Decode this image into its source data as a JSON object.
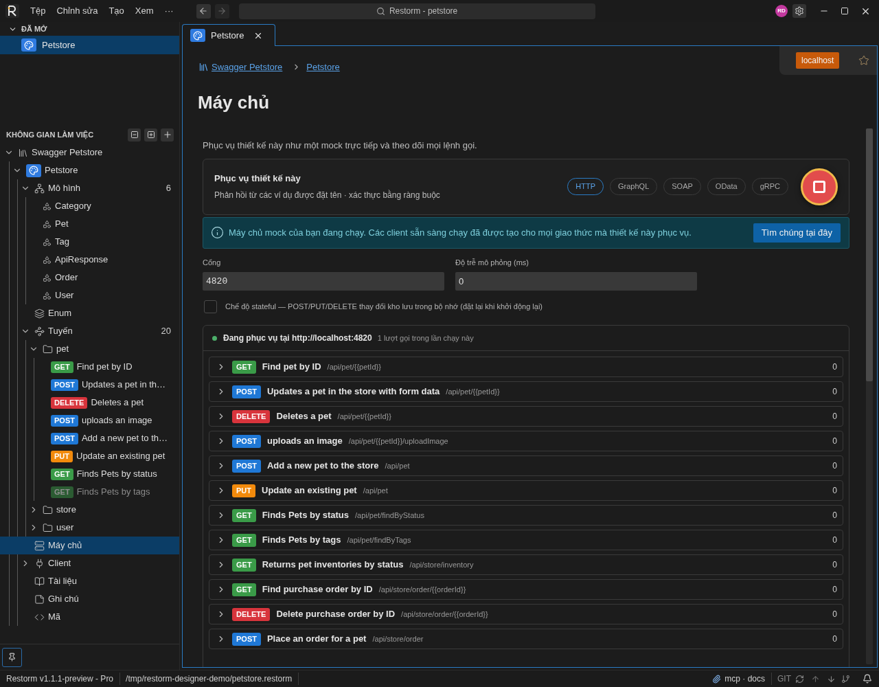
{
  "menu": [
    "Tệp",
    "Chỉnh sửa",
    "Tạo",
    "Xem",
    "···"
  ],
  "search": {
    "value": "Restorm - petstore"
  },
  "avatar": {
    "initials": "RD",
    "color": "#c2389e"
  },
  "open_section": {
    "title": "ĐÃ MỞ",
    "expanded": true,
    "items": [
      {
        "label": "Petstore",
        "selected": true
      }
    ]
  },
  "workspace": {
    "title": "KHÔNG GIAN LÀM VIỆC",
    "tree": [
      {
        "kind": "project",
        "label": "Swagger Petstore",
        "expanded": true,
        "children": [
          {
            "kind": "design",
            "label": "Petstore",
            "expanded": true,
            "children": [
              {
                "kind": "models",
                "label": "Mô hình",
                "count": "6",
                "expanded": true,
                "selected": false,
                "children": [
                  {
                    "kind": "model",
                    "label": "Category"
                  },
                  {
                    "kind": "model",
                    "label": "Pet"
                  },
                  {
                    "kind": "model",
                    "label": "Tag"
                  },
                  {
                    "kind": "model",
                    "label": "ApiResponse"
                  },
                  {
                    "kind": "model",
                    "label": "Order"
                  },
                  {
                    "kind": "model",
                    "label": "User"
                  }
                ]
              },
              {
                "kind": "enum",
                "label": "Enum",
                "selected": false
              },
              {
                "kind": "routes",
                "label": "Tuyến",
                "count": "20",
                "expanded": true,
                "selected": false,
                "children": [
                  {
                    "kind": "folder",
                    "label": "pet",
                    "expanded": true,
                    "children": [
                      {
                        "kind": "route",
                        "method": "GET",
                        "label": "Find pet by ID",
                        "disabled": false
                      },
                      {
                        "kind": "route",
                        "method": "POST",
                        "label": "Updates a pet in th…",
                        "disabled": false
                      },
                      {
                        "kind": "route",
                        "method": "DELETE",
                        "label": "Deletes a pet",
                        "disabled": false
                      },
                      {
                        "kind": "route",
                        "method": "POST",
                        "label": "uploads an image",
                        "disabled": false
                      },
                      {
                        "kind": "route",
                        "method": "POST",
                        "label": "Add a new pet to th…",
                        "disabled": false
                      },
                      {
                        "kind": "route",
                        "method": "PUT",
                        "label": "Update an existing pet",
                        "disabled": false
                      },
                      {
                        "kind": "route",
                        "method": "GET",
                        "label": "Finds Pets by status",
                        "disabled": false
                      },
                      {
                        "kind": "route",
                        "method": "GET",
                        "label": "Finds Pets by tags",
                        "disabled": true
                      }
                    ]
                  },
                  {
                    "kind": "folder",
                    "label": "store",
                    "expanded": false
                  },
                  {
                    "kind": "folder",
                    "label": "user",
                    "expanded": false
                  }
                ]
              },
              {
                "kind": "server",
                "label": "Máy chủ",
                "selected": true
              },
              {
                "kind": "client",
                "label": "Client",
                "expanded": false,
                "selected": false
              },
              {
                "kind": "docs",
                "label": "Tài liệu",
                "selected": false
              },
              {
                "kind": "notes",
                "label": "Ghi chú",
                "selected": false
              },
              {
                "kind": "code",
                "label": "Mã",
                "selected": false
              }
            ]
          }
        ]
      }
    ]
  },
  "tab": {
    "label": "Petstore"
  },
  "environment": "localhost",
  "breadcrumb": [
    "Swagger Petstore",
    "Petstore"
  ],
  "title": "Máy chủ",
  "description": "Phục vụ thiết kế này như một mock trực tiếp và theo dõi mọi lệnh gọi.",
  "serve_card": {
    "title": "Phục vụ thiết kế này",
    "subtitle": "Phản hồi từ các ví dụ được đặt tên · xác thực bằng ràng buộc",
    "protocols": [
      {
        "label": "HTTP",
        "selected": true
      },
      {
        "label": "GraphQL",
        "selected": false
      },
      {
        "label": "SOAP",
        "selected": false
      },
      {
        "label": "OData",
        "selected": false
      },
      {
        "label": "gRPC",
        "selected": false
      }
    ],
    "running": true
  },
  "banner": {
    "text": "Máy chủ mock của bạn đang chạy. Các client sẵn sàng chạy đã được tạo cho mọi giao thức mà thiết kế này phục vụ.",
    "button": "Tìm chúng tại đây"
  },
  "fields": [
    {
      "label": "Cổng",
      "value": "4820",
      "mono": true
    },
    {
      "label": "Độ trễ mô phỏng (ms)",
      "value": "0",
      "mono": false
    }
  ],
  "stateful": {
    "label": "Chế độ stateful — POST/PUT/DELETE thay đổi kho lưu trong bộ nhớ (đặt lại khi khởi động lại)",
    "checked": false
  },
  "requests": {
    "status": "Đang phục vụ tại http://localhost:4820",
    "color": "#4caf6a",
    "calls": "1 lượt gọi trong lần chạy này",
    "rows": [
      {
        "method": "GET",
        "title": "Find pet by ID",
        "path": "/api/pet/{{petId}}",
        "count": "0"
      },
      {
        "method": "POST",
        "title": "Updates a pet in the store with form data",
        "path": "/api/pet/{{petId}}",
        "count": "0"
      },
      {
        "method": "DELETE",
        "title": "Deletes a pet",
        "path": "/api/pet/{{petId}}",
        "count": "0"
      },
      {
        "method": "POST",
        "title": "uploads an image",
        "path": "/api/pet/{{petId}}/uploadImage",
        "count": "0"
      },
      {
        "method": "POST",
        "title": "Add a new pet to the store",
        "path": "/api/pet",
        "count": "0"
      },
      {
        "method": "PUT",
        "title": "Update an existing pet",
        "path": "/api/pet",
        "count": "0"
      },
      {
        "method": "GET",
        "title": "Finds Pets by status",
        "path": "/api/pet/findByStatus",
        "count": "0"
      },
      {
        "method": "GET",
        "title": "Finds Pets by tags",
        "path": "/api/pet/findByTags",
        "count": "0"
      },
      {
        "method": "GET",
        "title": "Returns pet inventories by status",
        "path": "/api/store/inventory",
        "count": "0"
      },
      {
        "method": "GET",
        "title": "Find purchase order by ID",
        "path": "/api/store/order/{{orderId}}",
        "count": "0"
      },
      {
        "method": "DELETE",
        "title": "Delete purchase order by ID",
        "path": "/api/store/order/{{orderId}}",
        "count": "0"
      },
      {
        "method": "POST",
        "title": "Place an order for a pet",
        "path": "/api/store/order",
        "count": "0"
      }
    ]
  },
  "status_bar": {
    "version": "Restorm v1.1.1-preview - Pro",
    "path": "/tmp/restorm-designer-demo/petstore.restorm",
    "mcp": "mcp · docs",
    "git": "GIT"
  }
}
